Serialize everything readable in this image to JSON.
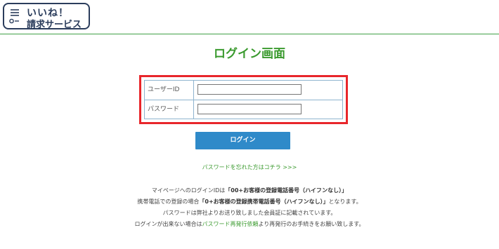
{
  "header": {
    "logo": {
      "line1": "いいね！",
      "line2": "請求サービス"
    }
  },
  "page_title": "ログイン画面",
  "login_form": {
    "user_id_label": "ユーザーID",
    "user_id_value": "",
    "password_label": "パスワード",
    "password_value": ""
  },
  "login_button_label": "ログイン",
  "forgot_link": "パスワードを忘れた方はコチラ >>>",
  "info": {
    "line1_prefix": "マイページへのログインIDは",
    "line1_bold": "「00+お客様の登録電話番号（ハイフンなし）」",
    "line2_prefix": "携帯電話での登録の場合",
    "line2_bold": "「0+お客様の登録携帯電話番号（ハイフンなし）」",
    "line2_suffix": "となります。",
    "line3": "パスワードは弊社よりお送り致しました会員証に記載されています。",
    "line4_prefix": "ログインが出来ない場合は",
    "line4_link": "パスワード再発行依頼",
    "line4_suffix": "より再発行のお手続きをお願い致します。"
  },
  "colors": {
    "brand_navy": "#2b3d5c",
    "title_green": "#3a9a2e",
    "button_blue": "#2f8ac9",
    "highlight_red": "#e8262b",
    "table_border": "#8fb4cf"
  }
}
